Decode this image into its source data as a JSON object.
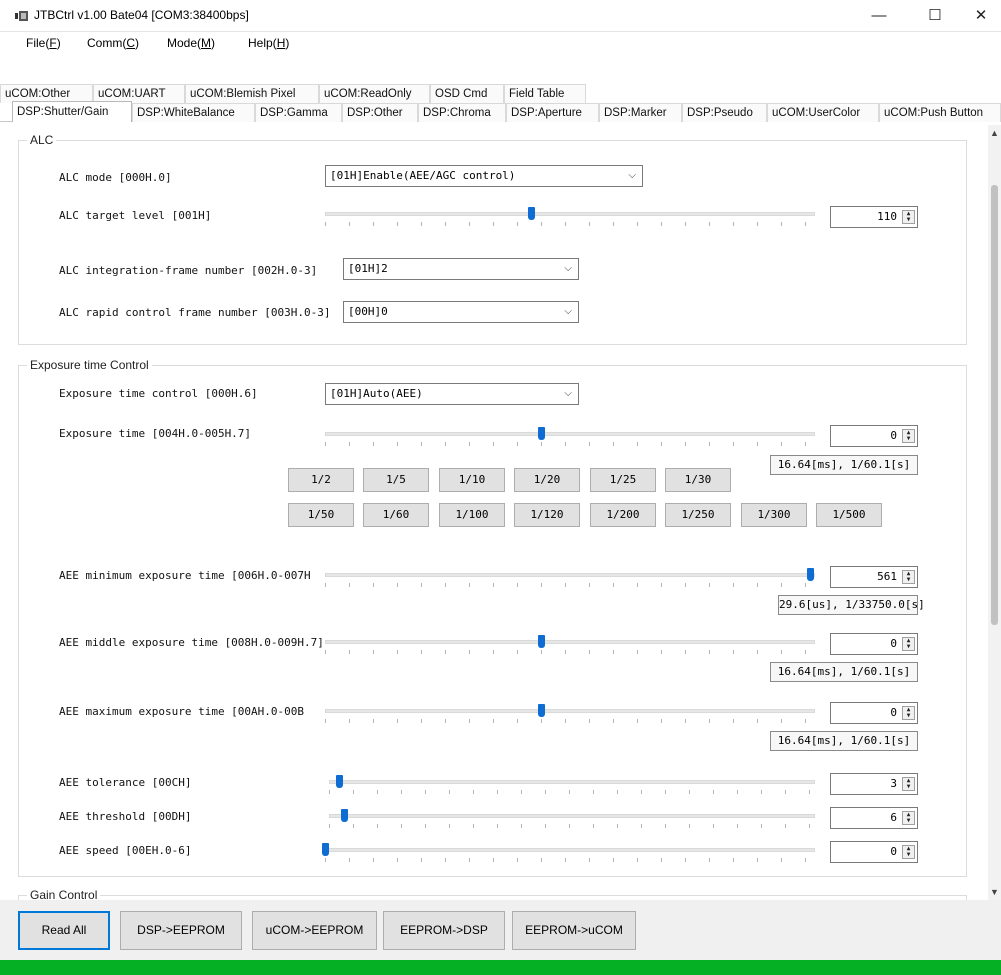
{
  "window": {
    "title": "JTBCtrl v1.00 Bate04 [COM3:38400bps]",
    "min_glyph": "—",
    "max_glyph": "☐",
    "close_glyph": "✕"
  },
  "menu": [
    {
      "label": "File(",
      "key": "F",
      "tail": ")"
    },
    {
      "label": "Comm(",
      "key": "C",
      "tail": ")"
    },
    {
      "label": "Mode(",
      "key": "M",
      "tail": ")"
    },
    {
      "label": "Help(",
      "key": "H",
      "tail": ")"
    }
  ],
  "tabs_row1": [
    "uCOM:Other",
    "uCOM:UART",
    "uCOM:Blemish Pixel",
    "uCOM:ReadOnly",
    "OSD Cmd",
    "Field Table"
  ],
  "tabs_row2": [
    "DSP:Shutter/Gain",
    "DSP:WhiteBalance",
    "DSP:Gamma",
    "DSP:Other",
    "DSP:Chroma",
    "DSP:Aperture",
    "DSP:Marker",
    "DSP:Pseudo",
    "uCOM:UserColor",
    "uCOM:Push Button"
  ],
  "active_tab": "DSP:Shutter/Gain",
  "alc": {
    "title": "ALC",
    "mode_label": "ALC mode [000H.0]",
    "mode_value": "[01H]Enable(AEE/AGC control)",
    "target_label": "ALC target level [001H]",
    "target_value": "110",
    "target_level": 0.42,
    "integ_label": "ALC integration-frame number [002H.0-3]",
    "integ_value": "[01H]2",
    "rapid_label": "ALC rapid control frame number [003H.0-3]",
    "rapid_value": "[00H]0"
  },
  "exposure": {
    "title": "Exposure time Control",
    "ctrl_label": "Exposure time control [000H.6]",
    "ctrl_value": "[01H]Auto(AEE)",
    "time_label": "Exposure time [004H.0-005H.7]",
    "time_value": "0",
    "time_level": 0.44,
    "time_readout": "16.64[ms], 1/60.1[s]",
    "presets_row1": [
      "1/2",
      "1/5",
      "1/10",
      "1/20",
      "1/25",
      "1/30"
    ],
    "presets_row2": [
      "1/50",
      "1/60",
      "1/100",
      "1/120",
      "1/200",
      "1/250",
      "1/300",
      "1/500"
    ],
    "min_label": "AEE minimum exposure time [006H.0-007H",
    "min_value": "561",
    "min_level": 0.99,
    "min_readout": "29.6[us], 1/33750.0[s]",
    "mid_label": "AEE middle exposure time [008H.0-009H.7]",
    "mid_value": "0",
    "mid_level": 0.44,
    "mid_readout": "16.64[ms], 1/60.1[s]",
    "max_label": "AEE maximum exposure time [00AH.0-00B",
    "max_value": "0",
    "max_level": 0.44,
    "max_readout": "16.64[ms], 1/60.1[s]",
    "tol_label": "AEE tolerance [00CH]",
    "tol_value": "3",
    "tol_level": 0.02,
    "thr_label": "AEE threshold [00DH]",
    "thr_value": "6",
    "thr_level": 0.03,
    "spd_label": "AEE speed [00EH.0-6]",
    "spd_value": "0",
    "spd_level": 0.0
  },
  "gain": {
    "title": "Gain Control"
  },
  "bottom_buttons": [
    "Read All",
    "DSP->EEPROM",
    "uCOM->EEPROM",
    "EEPROM->DSP",
    "EEPROM->uCOM"
  ],
  "colors": {
    "accent": "#0f6cd2",
    "status_green": "#06b025",
    "focus_blue": "#0078d7"
  }
}
